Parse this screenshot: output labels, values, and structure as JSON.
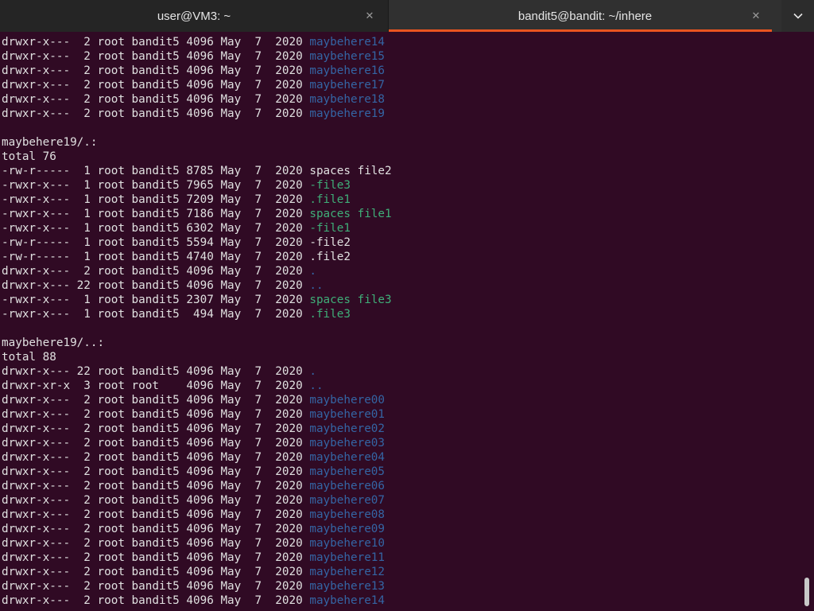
{
  "tabs": [
    {
      "title": "user@VM3: ~",
      "close_glyph": "✕"
    },
    {
      "title": "bandit5@bandit: ~/inhere",
      "close_glyph": "✕"
    }
  ],
  "menu_icon": "chevron-down-icon",
  "colors": {
    "background": "#300a24",
    "text": "#e0e0e0",
    "directory": "#3465a4",
    "executable": "#3fae78",
    "accent": "#e95420"
  },
  "lines": [
    {
      "meta": "drwxr-x---  2 root bandit5 4096 May  7  2020 ",
      "name": "maybehere14",
      "kind": "dir"
    },
    {
      "meta": "drwxr-x---  2 root bandit5 4096 May  7  2020 ",
      "name": "maybehere15",
      "kind": "dir"
    },
    {
      "meta": "drwxr-x---  2 root bandit5 4096 May  7  2020 ",
      "name": "maybehere16",
      "kind": "dir"
    },
    {
      "meta": "drwxr-x---  2 root bandit5 4096 May  7  2020 ",
      "name": "maybehere17",
      "kind": "dir"
    },
    {
      "meta": "drwxr-x---  2 root bandit5 4096 May  7  2020 ",
      "name": "maybehere18",
      "kind": "dir"
    },
    {
      "meta": "drwxr-x---  2 root bandit5 4096 May  7  2020 ",
      "name": "maybehere19",
      "kind": "dir"
    },
    {
      "meta": "",
      "name": "",
      "kind": "plain"
    },
    {
      "meta": "maybehere19/.:",
      "name": "",
      "kind": "plain"
    },
    {
      "meta": "total 76",
      "name": "",
      "kind": "plain"
    },
    {
      "meta": "-rw-r-----  1 root bandit5 8785 May  7  2020 ",
      "name": "spaces file2",
      "kind": "plain"
    },
    {
      "meta": "-rwxr-x---  1 root bandit5 7965 May  7  2020 ",
      "name": "-file3",
      "kind": "exe"
    },
    {
      "meta": "-rwxr-x---  1 root bandit5 7209 May  7  2020 ",
      "name": ".file1",
      "kind": "exe"
    },
    {
      "meta": "-rwxr-x---  1 root bandit5 7186 May  7  2020 ",
      "name": "spaces file1",
      "kind": "exe"
    },
    {
      "meta": "-rwxr-x---  1 root bandit5 6302 May  7  2020 ",
      "name": "-file1",
      "kind": "exe"
    },
    {
      "meta": "-rw-r-----  1 root bandit5 5594 May  7  2020 ",
      "name": "-file2",
      "kind": "plain"
    },
    {
      "meta": "-rw-r-----  1 root bandit5 4740 May  7  2020 ",
      "name": ".file2",
      "kind": "plain"
    },
    {
      "meta": "drwxr-x---  2 root bandit5 4096 May  7  2020 ",
      "name": ".",
      "kind": "dir"
    },
    {
      "meta": "drwxr-x--- 22 root bandit5 4096 May  7  2020 ",
      "name": "..",
      "kind": "dir"
    },
    {
      "meta": "-rwxr-x---  1 root bandit5 2307 May  7  2020 ",
      "name": "spaces file3",
      "kind": "exe"
    },
    {
      "meta": "-rwxr-x---  1 root bandit5  494 May  7  2020 ",
      "name": ".file3",
      "kind": "exe"
    },
    {
      "meta": "",
      "name": "",
      "kind": "plain"
    },
    {
      "meta": "maybehere19/..:",
      "name": "",
      "kind": "plain"
    },
    {
      "meta": "total 88",
      "name": "",
      "kind": "plain"
    },
    {
      "meta": "drwxr-x--- 22 root bandit5 4096 May  7  2020 ",
      "name": ".",
      "kind": "dir"
    },
    {
      "meta": "drwxr-xr-x  3 root root    4096 May  7  2020 ",
      "name": "..",
      "kind": "dir"
    },
    {
      "meta": "drwxr-x---  2 root bandit5 4096 May  7  2020 ",
      "name": "maybehere00",
      "kind": "dir"
    },
    {
      "meta": "drwxr-x---  2 root bandit5 4096 May  7  2020 ",
      "name": "maybehere01",
      "kind": "dir"
    },
    {
      "meta": "drwxr-x---  2 root bandit5 4096 May  7  2020 ",
      "name": "maybehere02",
      "kind": "dir"
    },
    {
      "meta": "drwxr-x---  2 root bandit5 4096 May  7  2020 ",
      "name": "maybehere03",
      "kind": "dir"
    },
    {
      "meta": "drwxr-x---  2 root bandit5 4096 May  7  2020 ",
      "name": "maybehere04",
      "kind": "dir"
    },
    {
      "meta": "drwxr-x---  2 root bandit5 4096 May  7  2020 ",
      "name": "maybehere05",
      "kind": "dir"
    },
    {
      "meta": "drwxr-x---  2 root bandit5 4096 May  7  2020 ",
      "name": "maybehere06",
      "kind": "dir"
    },
    {
      "meta": "drwxr-x---  2 root bandit5 4096 May  7  2020 ",
      "name": "maybehere07",
      "kind": "dir"
    },
    {
      "meta": "drwxr-x---  2 root bandit5 4096 May  7  2020 ",
      "name": "maybehere08",
      "kind": "dir"
    },
    {
      "meta": "drwxr-x---  2 root bandit5 4096 May  7  2020 ",
      "name": "maybehere09",
      "kind": "dir"
    },
    {
      "meta": "drwxr-x---  2 root bandit5 4096 May  7  2020 ",
      "name": "maybehere10",
      "kind": "dir"
    },
    {
      "meta": "drwxr-x---  2 root bandit5 4096 May  7  2020 ",
      "name": "maybehere11",
      "kind": "dir"
    },
    {
      "meta": "drwxr-x---  2 root bandit5 4096 May  7  2020 ",
      "name": "maybehere12",
      "kind": "dir"
    },
    {
      "meta": "drwxr-x---  2 root bandit5 4096 May  7  2020 ",
      "name": "maybehere13",
      "kind": "dir"
    },
    {
      "meta": "drwxr-x---  2 root bandit5 4096 May  7  2020 ",
      "name": "maybehere14",
      "kind": "dir"
    }
  ]
}
